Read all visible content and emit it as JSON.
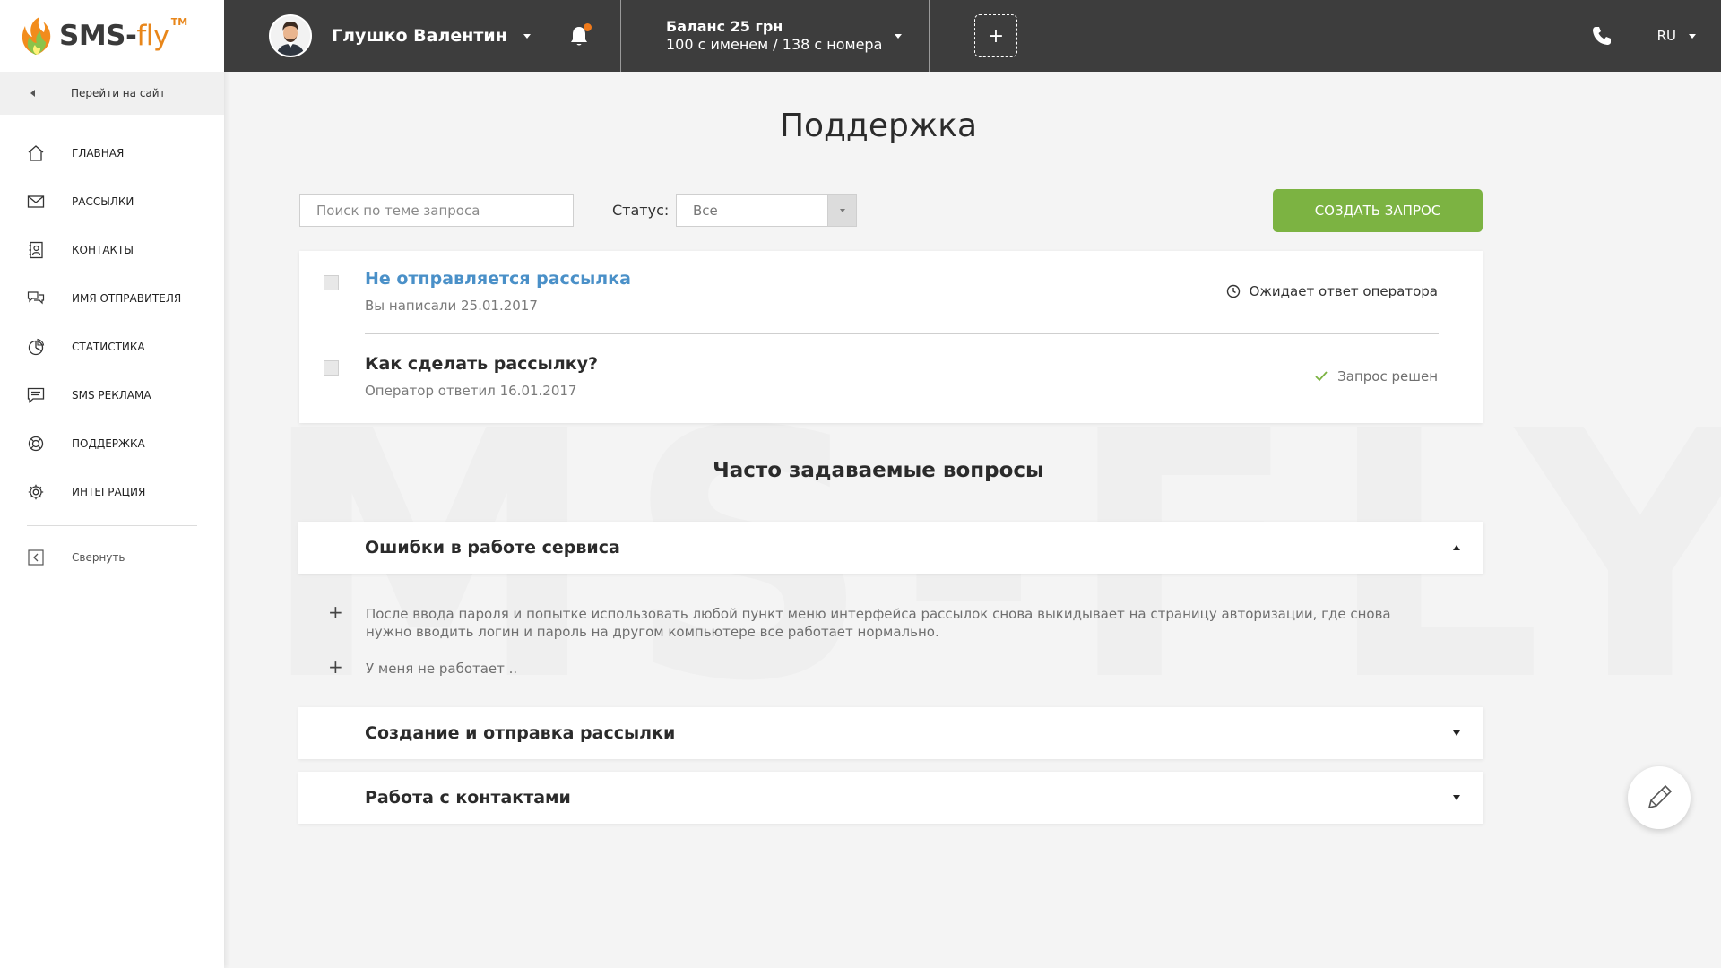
{
  "logo": {
    "brand_sms": "SMS-",
    "brand_fly": "fly",
    "tm": "TM"
  },
  "sidebar": {
    "goto_site": "Перейти на сайт",
    "items": [
      {
        "label": "Главная",
        "icon": "home-icon"
      },
      {
        "label": "Рассылки",
        "icon": "envelope-icon"
      },
      {
        "label": "Контакты",
        "icon": "contacts-icon"
      },
      {
        "label": "Имя отправителя",
        "icon": "chat-icon"
      },
      {
        "label": "Статистика",
        "icon": "pie-chart-icon"
      },
      {
        "label": "SMS реклама",
        "icon": "message-icon"
      },
      {
        "label": "Поддержка",
        "icon": "support-icon"
      },
      {
        "label": "Интеграция",
        "icon": "gear-icon"
      }
    ],
    "collapse": "Свернуть"
  },
  "header": {
    "user_name": "Глушко Валентин",
    "balance_line1": "Баланс 25 грн",
    "balance_line2": "100 с именем / 138 с номера",
    "add_label": "+",
    "language": "RU"
  },
  "main": {
    "title": "Поддержка",
    "search_placeholder": "Поиск по теме запроса",
    "status_label": "Статус:",
    "status_value": "Все",
    "create_button": "Создать запрос",
    "requests": [
      {
        "title": "Не отправляется рассылка",
        "subtitle": "Вы написали 25.01.2017",
        "status": "Ожидает ответ оператора",
        "title_color": "#4a90c8"
      },
      {
        "title": "Как сделать рассылку?",
        "subtitle": "Оператор ответил 16.01.2017",
        "status": "Запрос решен",
        "title_color": "#2b2b2b"
      }
    ],
    "faq_title": "Часто задаваемые вопросы",
    "faq": [
      {
        "question": "Ошибки в работе сервиса",
        "expanded": true,
        "subitems": [
          "После ввода пароля и попытке использовать любой пункт меню интерфейса рассылок снова выкидывает на страницу авторизации, где снова нужно вводить логин и пароль на другом компьютере все работает нормально.",
          "У меня не работает .."
        ]
      },
      {
        "question": "Создание и отправка рассылки",
        "expanded": false
      },
      {
        "question": "Работа с контактами",
        "expanded": false
      }
    ],
    "watermark": "MS-FLY"
  },
  "colors": {
    "accent_green": "#7cb342",
    "accent_orange": "#e8861a",
    "topbar": "#3d3d3d",
    "link_blue": "#4a90c8"
  }
}
